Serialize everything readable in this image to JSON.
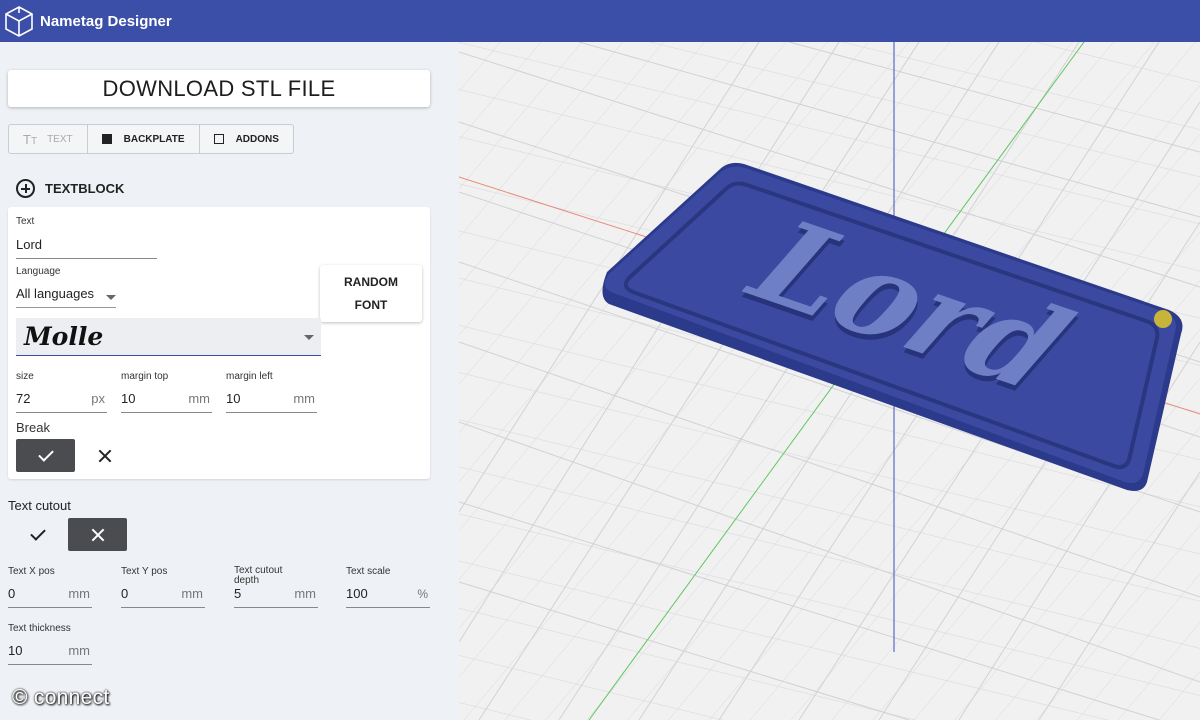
{
  "app": {
    "title": "Nametag Designer"
  },
  "actions": {
    "download_label": "DOWNLOAD STL FILE",
    "random_font_line1": "RANDOM",
    "random_font_line2": "FONT"
  },
  "tabs": [
    {
      "label": "TEXT",
      "state": "disabled"
    },
    {
      "label": "BACKPLATE",
      "state": "enabled"
    },
    {
      "label": "ADDONS",
      "state": "enabled"
    }
  ],
  "textblock": {
    "header": "TEXTBLOCK",
    "text_label": "Text",
    "text_value": "Lord",
    "language_label": "Language",
    "language_value": "All languages",
    "font_value": "Molle",
    "size_label": "size",
    "size_value": "72",
    "size_unit": "px",
    "margin_top_label": "margin top",
    "margin_top_value": "10",
    "margin_top_unit": "mm",
    "margin_left_label": "margin left",
    "margin_left_value": "10",
    "margin_left_unit": "mm",
    "break_label": "Break",
    "break_value": true
  },
  "cutout": {
    "label": "Text cutout",
    "value": false,
    "x_pos_label": "Text X pos",
    "x_pos_value": "0",
    "x_pos_unit": "mm",
    "y_pos_label": "Text Y pos",
    "y_pos_value": "0",
    "y_pos_unit": "mm",
    "depth_label_1": "Text cutout",
    "depth_label_2": "depth",
    "depth_value": "5",
    "depth_unit": "mm",
    "scale_label": "Text scale",
    "scale_value": "100",
    "scale_unit": "%",
    "thickness_label": "Text thickness",
    "thickness_value": "10",
    "thickness_unit": "mm"
  },
  "viewport": {
    "model_text": "Lord",
    "plate_color": "#3b4aa0",
    "text_color": "#6f7fc6",
    "hole_color": "#c8b43a"
  },
  "watermark": "© connect",
  "colors": {
    "header": "#3b4fa8",
    "panel": "#eef1f5",
    "toggle_active": "#4a4c4f"
  }
}
